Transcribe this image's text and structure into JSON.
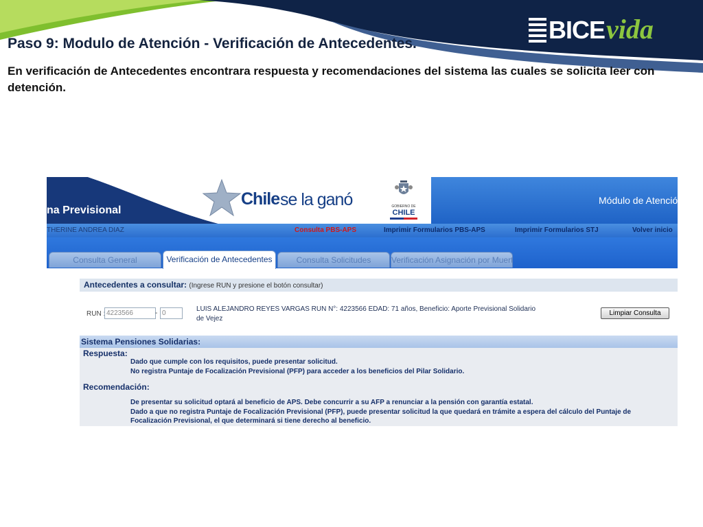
{
  "slide": {
    "title": "Paso 9: Modulo de Atención - Verificación de Antecedentes.",
    "description": " En verificación de Antecedentes encontrara respuesta y recomendaciones del sistema las cuales se solicita leer con detención.",
    "logo": {
      "bice": "BICE",
      "vida": "vida"
    }
  },
  "app": {
    "banner": {
      "system_name": "na Previsional",
      "slogan_bold": "Chile",
      "slogan_rest": "se la ganó",
      "gobierno_top": "GOBIERNO DE",
      "gobierno_chile": "CHILE",
      "module_title": "Módulo de Atención"
    },
    "nav": {
      "user": "THERINE ANDREA DIAZ",
      "links": [
        "Consulta PBS-APS",
        "Imprimir Formularios PBS-APS",
        "Imprimir Formularios STJ",
        "Volver inicio"
      ]
    },
    "tabs": [
      {
        "label": "Consulta General",
        "active": false
      },
      {
        "label": "Verificación de Antecedentes",
        "active": true
      },
      {
        "label": "Consulta Solicitudes",
        "active": false
      },
      {
        "label": "Verificación Asignación por Muerte",
        "active": false
      }
    ],
    "consulta": {
      "title": "Antecedentes a consultar:",
      "hint": "(Ingrese RUN y presione el botón consultar)",
      "run_label": "RUN :",
      "run_value": "4223566",
      "dash": "-",
      "dv_value": "0",
      "person_info": "LUIS ALEJANDRO REYES VARGAS  RUN N°: 4223566  EDAD: 71 años, Beneficio: Aporte Previsional Solidario de Vejez",
      "clear_button": "Limpiar Consulta"
    },
    "sps": {
      "title": "Sistema Pensiones Solidarias:",
      "respuesta_label": "Respuesta:",
      "respuesta_lines": [
        "Dado que cumple con los requisitos, puede presentar solicitud.",
        "No registra Puntaje de Focalización Previsional (PFP) para acceder a los beneficios del Pilar Solidario."
      ],
      "recomendacion_label": "Recomendación:",
      "recomendacion_lines": [
        "De presentar su solicitud optará al beneficio de APS. Debe concurrir a su AFP a renunciar a la pensión con garantía estatal.",
        "Dado a que no registra Puntaje de Focalización Previsional (PFP), puede presentar solicitud la que quedará en trámite a espera del cálculo del Puntaje de",
        "Focalización Previsional, el que determinará si tiene derecho al beneficio."
      ]
    }
  },
  "colors": {
    "navy": "#14233f",
    "green": "#8cc63f",
    "app_blue": "#1f63c6",
    "nav_red": "#d01818"
  }
}
